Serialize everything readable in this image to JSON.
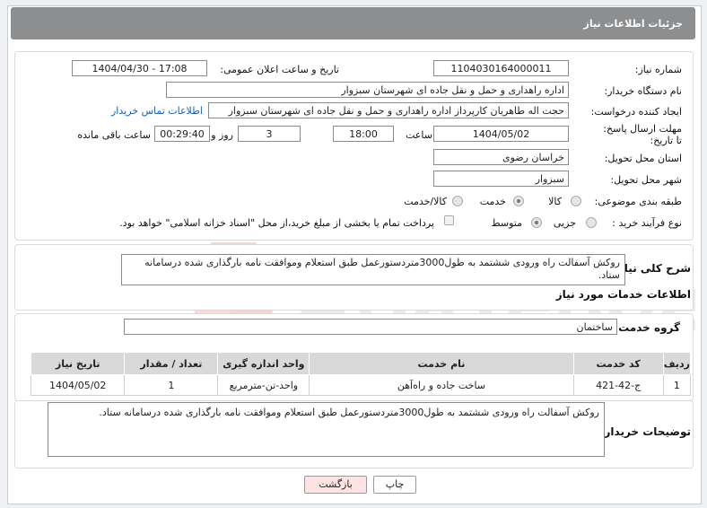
{
  "header": {
    "title": "جزئیات اطلاعات نیاز"
  },
  "form": {
    "need_number_label": "شماره نیاز:",
    "need_number": "1104030164000011",
    "announce_label": "تاریخ و ساعت اعلان عمومی:",
    "announce_value": "1404/04/30 - 17:08",
    "buyer_org_label": "نام دستگاه خریدار:",
    "buyer_org": "اداره راهداری و حمل و نقل جاده ای شهرستان سبزوار",
    "creator_label": "ایجاد کننده درخواست:",
    "creator": "حجت اله طاهریان کارپرداز اداره راهداری و حمل و نقل جاده ای شهرستان سبزوار",
    "contact_link": "اطلاعات تماس خریدار",
    "deadline_label": "مهلت ارسال پاسخ: تا تاریخ:",
    "deadline_date": "1404/05/02",
    "time_label": "ساعت",
    "deadline_time": "18:00",
    "days_value": "3",
    "days_label": "روز و",
    "remaining_time": "00:29:40",
    "remaining_label": "ساعت باقی مانده",
    "province_label": "استان محل تحویل:",
    "province": "خراسان رضوی",
    "city_label": "شهر محل تحویل:",
    "city": "سبزوار",
    "category_label": "طبقه بندی موضوعی:",
    "category_options": [
      "کالا",
      "خدمت",
      "کالا/خدمت"
    ],
    "category_selected": "خدمت",
    "process_label": "نوع فرآیند خرید :",
    "process_options": [
      "جزیی",
      "متوسط"
    ],
    "process_selected": "متوسط",
    "payment_note": "پرداخت تمام یا بخشی از مبلغ خرید،از محل \"اسناد خزانه اسلامی\" خواهد بود."
  },
  "summary": {
    "label": "شرح کلی نیاز:",
    "text": "روکش آسفالت راه ورودی ششتمد به طول3000متردستورعمل طبق استعلام وموافقت نامه بارگذاری شده درسامانه ستاد."
  },
  "services": {
    "section_title": "اطلاعات خدمات مورد نیاز",
    "group_label": "گروه خدمت:",
    "group_value": "ساختمان",
    "columns": [
      "ردیف",
      "کد خدمت",
      "نام خدمت",
      "واحد اندازه گیری",
      "تعداد / مقدار",
      "تاریخ نیاز"
    ],
    "rows": [
      {
        "row": "1",
        "code": "ج-42-421",
        "name": "ساخت جاده و راه‌آهن",
        "unit": "واحد-تن-مترمربع",
        "qty": "1",
        "date": "1404/05/02"
      }
    ]
  },
  "buyer_notes": {
    "label": "توضیحات خریدار:",
    "text": "روکش آسفالت راه ورودی ششتمد به طول3000متردستورعمل طبق استعلام وموافقت نامه بارگذاری شده درسامانه ستاد."
  },
  "buttons": {
    "print": "چاپ",
    "back": "بازگشت"
  },
  "colors": {
    "header_bg": "#8d8e90",
    "back_button_bg": "#fde3e3",
    "link": "#1a5fb4"
  }
}
